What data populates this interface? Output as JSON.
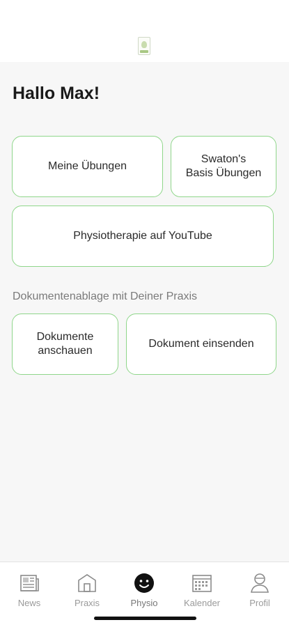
{
  "header": {
    "logo_icon": "praxis-logo"
  },
  "greeting": "Hallo Max!",
  "tiles": {
    "meine_uebungen": "Meine Übungen",
    "swaton_basis": "Swaton's\nBasis Übungen",
    "youtube": "Physiotherapie auf YouTube"
  },
  "documents": {
    "section_label": "Dokumentenablage mit Deiner Praxis",
    "view": "Dokumente\nanschauen",
    "send": "Dokument einsenden"
  },
  "tabbar": {
    "items": [
      {
        "label": "News",
        "icon": "newspaper-icon"
      },
      {
        "label": "Praxis",
        "icon": "building-icon"
      },
      {
        "label": "Physio",
        "icon": "smiley-icon",
        "active": true
      },
      {
        "label": "Kalender",
        "icon": "calendar-icon"
      },
      {
        "label": "Profil",
        "icon": "person-icon"
      }
    ]
  },
  "colors": {
    "accent_border": "#8fd68a",
    "background": "#f7f7f7",
    "tab_label": "#9a9a9a"
  }
}
